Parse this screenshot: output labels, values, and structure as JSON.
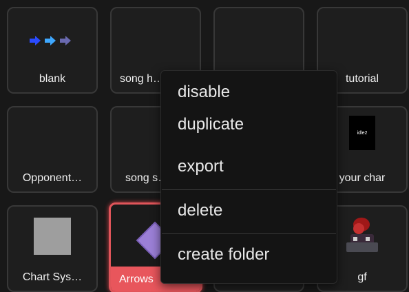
{
  "tiles": [
    {
      "label": "blank"
    },
    {
      "label": "song h…"
    },
    {
      "label": ""
    },
    {
      "label": "tutorial"
    },
    {
      "label": "Opponent…"
    },
    {
      "label": "song s…"
    },
    {
      "label": ""
    },
    {
      "label": "your char"
    },
    {
      "label": "Chart Sys…"
    },
    {
      "label": "Arrows"
    },
    {
      "label": ""
    },
    {
      "label": "gf"
    }
  ],
  "thumb_text": {
    "idle": "idle2"
  },
  "context_menu": {
    "items": [
      {
        "label": "disable"
      },
      {
        "label": "duplicate"
      },
      {
        "label": "export"
      },
      {
        "label": "delete"
      },
      {
        "label": "create folder"
      }
    ]
  },
  "colors": {
    "background": "#181818",
    "tile_border": "#383838",
    "selected_accent": "#e8565c",
    "menu_bg": "#141414"
  },
  "icons": {
    "blank_thumb": "triple-arrow-icon",
    "arrows_thumb": "purple-arrow-note-icon",
    "gf_thumb": "character-sprite-icon"
  }
}
